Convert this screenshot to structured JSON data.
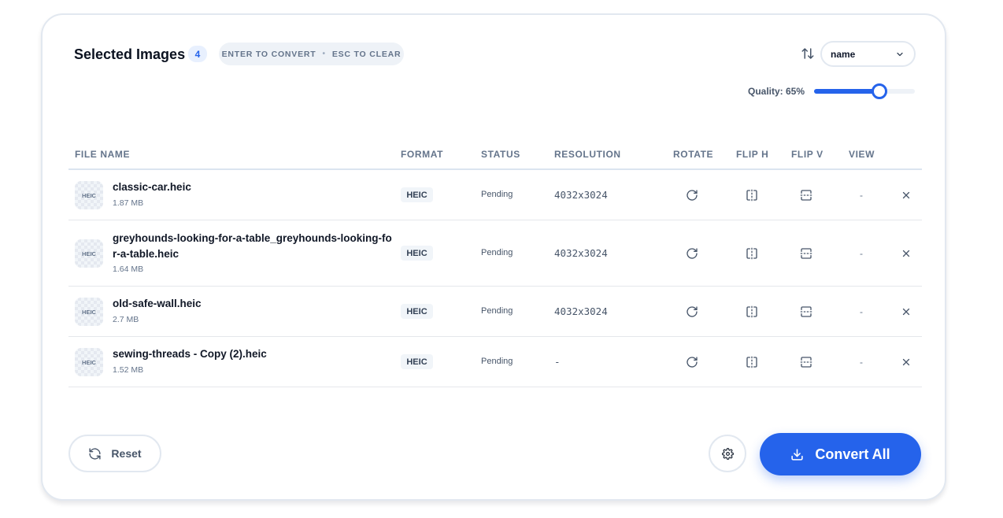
{
  "header": {
    "title": "Selected Images",
    "count": "4",
    "hint_convert": "ENTER TO CONVERT",
    "hint_sep": "•",
    "hint_clear": "ESC TO CLEAR",
    "sort_value": "name",
    "quality_label": "Quality: 65%",
    "quality_value": 65
  },
  "columns": {
    "file_name": "FILE NAME",
    "format": "FORMAT",
    "status": "STATUS",
    "resolution": "RESOLUTION",
    "rotate": "ROTATE",
    "flip_h": "FLIP H",
    "flip_v": "FLIP V",
    "view": "VIEW"
  },
  "files": [
    {
      "thumb": "HEIC",
      "name": "classic-car.heic",
      "size": "1.87 MB",
      "format": "HEIC",
      "status": "Pending",
      "resolution": "4032x3024",
      "view": "-"
    },
    {
      "thumb": "HEIC",
      "name": "greyhounds-looking-for-a-table_greyhounds-looking-for-a-table.heic",
      "size": "1.64 MB",
      "format": "HEIC",
      "status": "Pending",
      "resolution": "4032x3024",
      "view": "-"
    },
    {
      "thumb": "HEIC",
      "name": "old-safe-wall.heic",
      "size": "2.7 MB",
      "format": "HEIC",
      "status": "Pending",
      "resolution": "4032x3024",
      "view": "-"
    },
    {
      "thumb": "HEIC",
      "name": "sewing-threads - Copy (2).heic",
      "size": "1.52 MB",
      "format": "HEIC",
      "status": "Pending",
      "resolution": "-",
      "view": "-"
    }
  ],
  "footer": {
    "reset_label": "Reset",
    "convert_label": "Convert All"
  },
  "colors": {
    "accent": "#2563eb",
    "border": "#e2e8f0",
    "muted_text": "#64748b"
  },
  "icons": {
    "sort": "sort-arrows-icon",
    "dropdown": "chevron-down-icon",
    "rotate": "rotate-cw-icon",
    "flip_h": "flip-horizontal-icon",
    "flip_v": "flip-vertical-icon",
    "remove": "close-icon",
    "reset": "refresh-icon",
    "settings": "gear-icon",
    "convert": "download-icon"
  }
}
